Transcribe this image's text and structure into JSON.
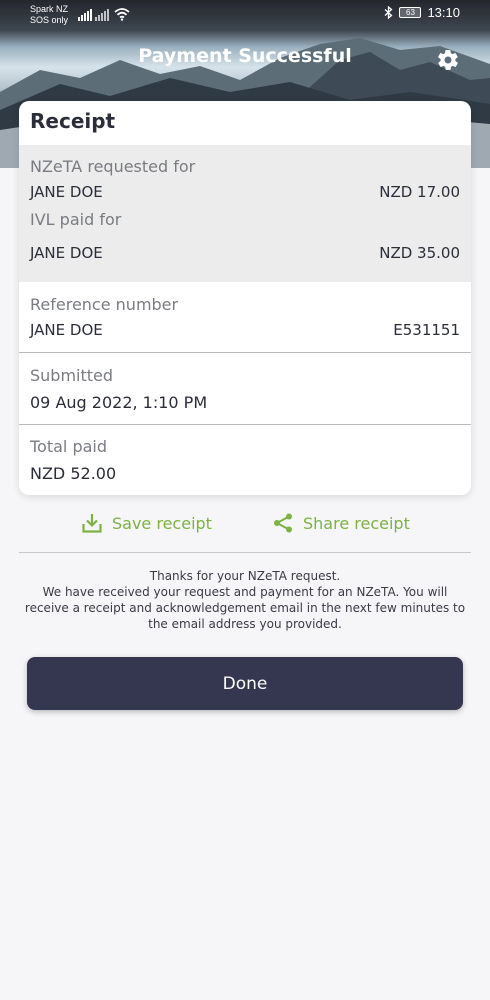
{
  "status_bar": {
    "carrier_line1": "Spark NZ",
    "carrier_line2": "SOS only",
    "battery": "63",
    "time": "13:10"
  },
  "header": {
    "title": "Payment Successful",
    "settings_icon": "gear-icon"
  },
  "receipt": {
    "title": "Receipt",
    "nzeta_label": "NZeTA requested for",
    "nzeta_name": "JANE DOE",
    "nzeta_amount": "NZD 17.00",
    "ivl_label": "IVL paid for",
    "ivl_name": "JANE DOE",
    "ivl_amount": "NZD 35.00",
    "reference_label": "Reference number",
    "reference_name": "JANE DOE",
    "reference_value": "E531151",
    "submitted_label": "Submitted",
    "submitted_value": "09 Aug 2022, 1:10 PM",
    "total_label": "Total paid",
    "total_value": "NZD 52.00"
  },
  "actions": {
    "save_label": "Save receipt",
    "save_icon": "download-icon",
    "share_label": "Share receipt",
    "share_icon": "share-icon",
    "accent_color": "#7cb342"
  },
  "message": {
    "line1": "Thanks for your NZeTA request.",
    "line2": "We have received your request and payment for an NZeTA. You will receive a receipt and acknowledgement email in the next few minutes to the email address you provided."
  },
  "done_button": {
    "label": "Done",
    "color": "#35364f"
  }
}
